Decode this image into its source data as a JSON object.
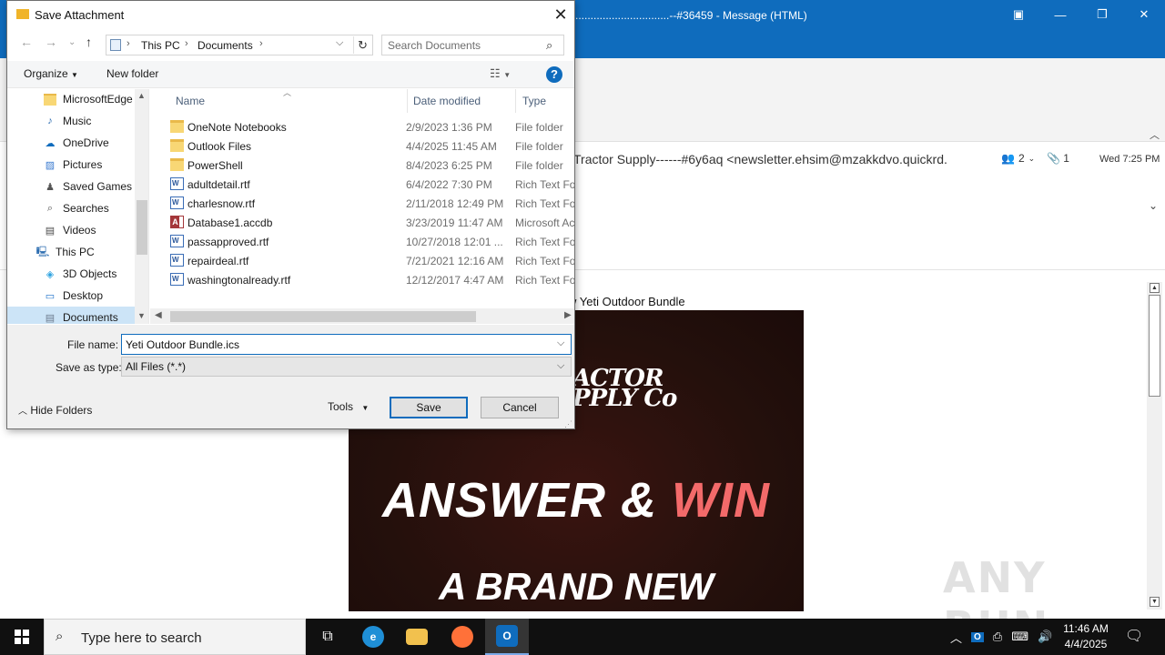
{
  "outlook": {
    "window_title": "...............................--#36459  -  Message (HTML)",
    "from_line": "Tractor Supply------#6y6aq <newsletter.ehsim@mzakkdvo.quickrd.",
    "people_count": "2",
    "attachment_count": "1",
    "date": "Wed 7:25 PM",
    "subject_fragment": "w Yeti Outdoor Bundle",
    "promo": {
      "logo_line1": "ACTOR",
      "logo_line2": "PPLY Co",
      "headline_part1": "ANSWER & ",
      "headline_part2": "WIN",
      "subheadline": "A BRAND NEW"
    },
    "watermark": "ANY RUN"
  },
  "dialog": {
    "title": "Save Attachment",
    "path": {
      "root": "This PC",
      "folder": "Documents"
    },
    "search_placeholder": "Search Documents",
    "toolbar": {
      "organize": "Organize",
      "new_folder": "New folder",
      "help": "?"
    },
    "nav_items": [
      {
        "label": "MicrosoftEdge",
        "icon": "folder-icon",
        "indent": 2
      },
      {
        "label": "Music",
        "icon": "music-icon",
        "indent": 2
      },
      {
        "label": "OneDrive",
        "icon": "cloud-icon",
        "indent": 2
      },
      {
        "label": "Pictures",
        "icon": "pictures-icon",
        "indent": 2
      },
      {
        "label": "Saved Games",
        "icon": "saved-games-icon",
        "indent": 2
      },
      {
        "label": "Searches",
        "icon": "search-icon",
        "indent": 2
      },
      {
        "label": "Videos",
        "icon": "videos-icon",
        "indent": 2
      },
      {
        "label": "This PC",
        "icon": "computer-icon",
        "indent": 1
      },
      {
        "label": "3D Objects",
        "icon": "cube-icon",
        "indent": 2
      },
      {
        "label": "Desktop",
        "icon": "desktop-icon",
        "indent": 2
      },
      {
        "label": "Documents",
        "icon": "documents-icon",
        "indent": 2,
        "selected": true
      }
    ],
    "columns": {
      "name": "Name",
      "date": "Date modified",
      "type": "Type"
    },
    "files": [
      {
        "name": "OneNote Notebooks",
        "date": "2/9/2023 1:36 PM",
        "type": "File folder",
        "kind": "folder"
      },
      {
        "name": "Outlook Files",
        "date": "4/4/2025 11:45 AM",
        "type": "File folder",
        "kind": "folder"
      },
      {
        "name": "PowerShell",
        "date": "8/4/2023 6:25 PM",
        "type": "File folder",
        "kind": "folder"
      },
      {
        "name": "adultdetail.rtf",
        "date": "6/4/2022 7:30 PM",
        "type": "Rich Text Format",
        "kind": "rtf"
      },
      {
        "name": "charlesnow.rtf",
        "date": "2/11/2018 12:49 PM",
        "type": "Rich Text Format",
        "kind": "rtf"
      },
      {
        "name": "Database1.accdb",
        "date": "3/23/2019 11:47 AM",
        "type": "Microsoft Access",
        "kind": "accdb"
      },
      {
        "name": "passapproved.rtf",
        "date": "10/27/2018 12:01 ...",
        "type": "Rich Text Format",
        "kind": "rtf"
      },
      {
        "name": "repairdeal.rtf",
        "date": "7/21/2021 12:16 AM",
        "type": "Rich Text Format",
        "kind": "rtf"
      },
      {
        "name": "washingtonalready.rtf",
        "date": "12/12/2017 4:47 AM",
        "type": "Rich Text Format",
        "kind": "rtf"
      }
    ],
    "form": {
      "file_name_label": "File name:",
      "file_name_value": "Yeti Outdoor Bundle.ics",
      "save_as_type_label": "Save as type:",
      "save_as_type_value": "All Files (*.*)",
      "hide_folders": "Hide Folders",
      "tools": "Tools",
      "save": "Save",
      "cancel": "Cancel"
    }
  },
  "taskbar": {
    "search_placeholder": "Type here to search",
    "time": "11:46 AM",
    "date": "4/4/2025"
  },
  "colors": {
    "outlook_blue": "#0f6cbd",
    "promo_bg": "#24100c",
    "promo_accent": "#f36a6a",
    "taskbar": "#101010"
  }
}
